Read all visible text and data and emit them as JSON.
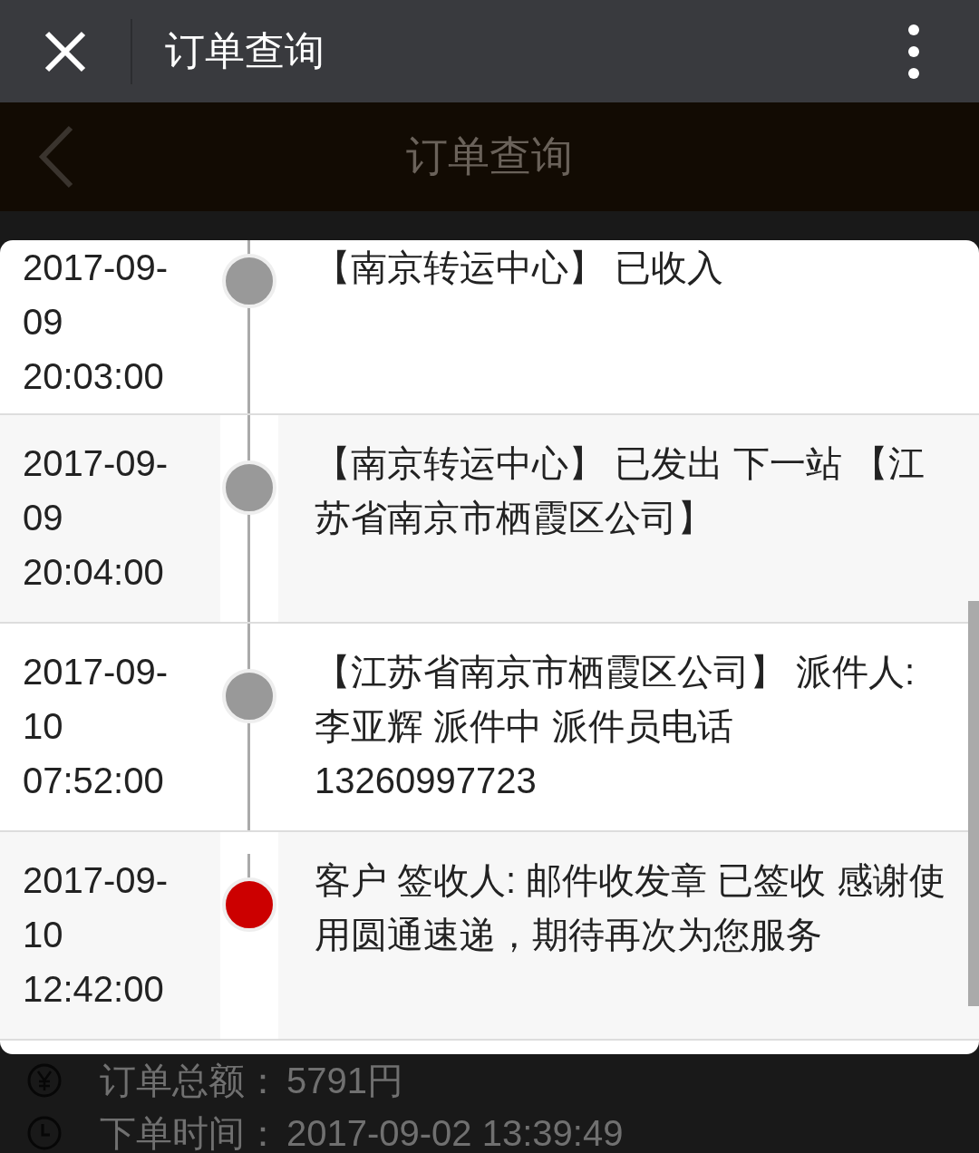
{
  "top_bar": {
    "title": "订单查询"
  },
  "page_header": {
    "title": "订单查询"
  },
  "tracking": [
    {
      "time": [
        "2017-09-",
        "09",
        "20:03:00"
      ],
      "text": "【南京转运中心】 已收入",
      "current": false
    },
    {
      "time": [
        "2017-09-",
        "09",
        "20:04:00"
      ],
      "text": "【南京转运中心】 已发出 下一站 【江苏省南京市栖霞区公司】",
      "current": false
    },
    {
      "time": [
        "2017-09-",
        "10",
        "07:52:00"
      ],
      "text": "【江苏省南京市栖霞区公司】 派件人: 李亚辉 派件中 派件员电话 13260997723",
      "current": false
    },
    {
      "time": [
        "2017-09-",
        "10",
        "12:42:00"
      ],
      "text": "客户 签收人: 邮件收发章 已签收 感谢使用圆通速递，期待再次为您服务",
      "current": true
    }
  ],
  "order_info": [
    {
      "kind": "amount",
      "label": "订单总额：",
      "value": "5791円"
    },
    {
      "kind": "time",
      "label": "下单时间：",
      "value": "2017-09-02 13:39:49"
    }
  ]
}
